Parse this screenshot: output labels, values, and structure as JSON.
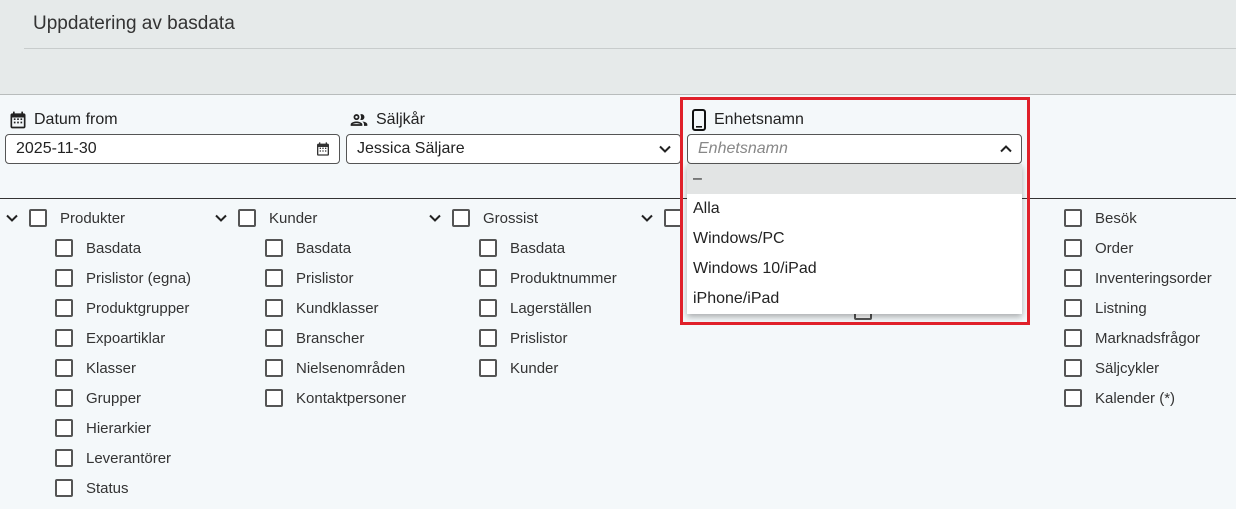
{
  "header": {
    "title": "Uppdatering av basdata"
  },
  "fields": {
    "datum": {
      "label": "Datum from",
      "value": "2025-11-30"
    },
    "saljkar": {
      "label": "Säljkår",
      "value": "Jessica Säljare"
    },
    "enhet": {
      "label": "Enhetsnamn",
      "placeholder": "Enhetsnamn"
    }
  },
  "dropdown": {
    "options": [
      "–",
      "Alla",
      "Windows/PC",
      "Windows 10/iPad",
      "iPhone/iPad"
    ],
    "selected_index": 0
  },
  "groups": {
    "produkter": {
      "label": "Produkter",
      "items": [
        "Basdata",
        "Prislistor (egna)",
        "Produktgrupper",
        "Expoartiklar",
        "Klasser",
        "Grupper",
        "Hierarkier",
        "Leverantörer",
        "Status"
      ]
    },
    "kunder": {
      "label": "Kunder",
      "items": [
        "Basdata",
        "Prislistor",
        "Kundklasser",
        "Branscher",
        "Nielsenområden",
        "Kontaktpersoner"
      ]
    },
    "grossist": {
      "label": "Grossist",
      "items": [
        "Basdata",
        "Produktnummer",
        "Lagerställen",
        "Prislistor",
        "Kunder"
      ]
    },
    "besok": {
      "items": [
        "Besök",
        "Order",
        "Inventeringsorder",
        "Listning",
        "Marknadsfrågor",
        "Säljcykler",
        "Kalender (*)"
      ]
    }
  },
  "colors": {
    "highlight": "#e0202a",
    "header_bg": "#e6eaea",
    "page_bg": "#f4f8fa"
  }
}
